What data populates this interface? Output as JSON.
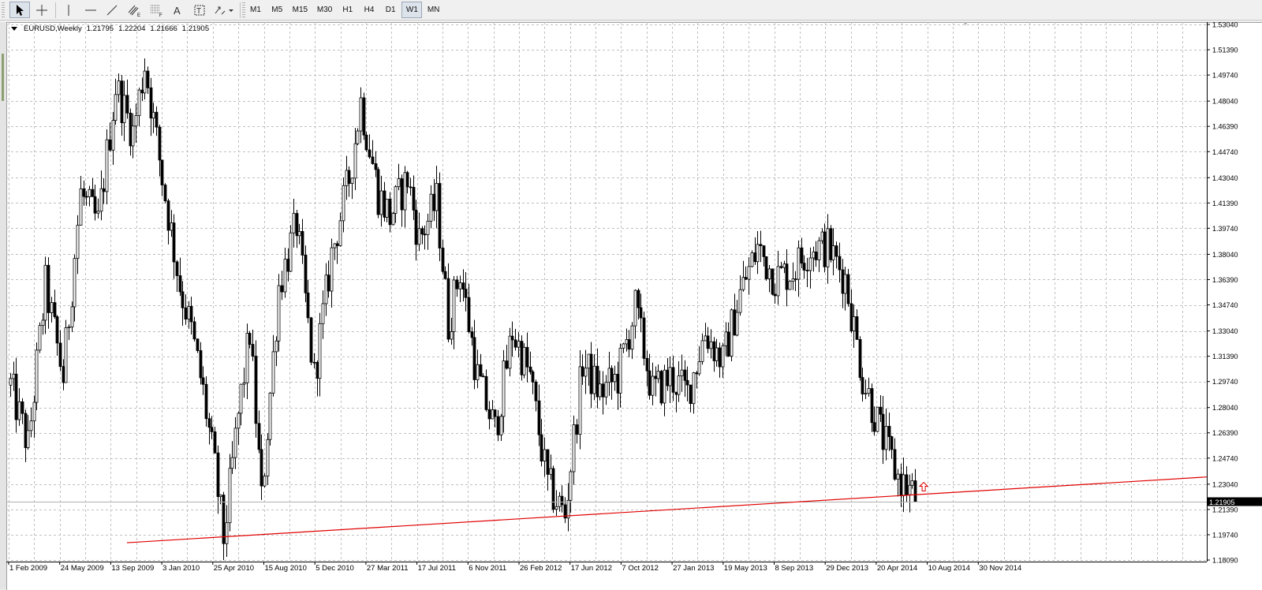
{
  "toolbar": {
    "tools": [
      "cursor-icon",
      "crosshair-icon",
      "vertical-line-icon",
      "horizontal-line-icon",
      "trendline-icon",
      "equidistant-channel-icon",
      "fibonacci-retracement-icon",
      "text-icon",
      "text-label-icon",
      "arrows-dropdown-icon"
    ],
    "timeframes": [
      "M1",
      "M5",
      "M15",
      "M30",
      "H1",
      "H4",
      "D1",
      "W1",
      "MN"
    ],
    "active_timeframe": "W1"
  },
  "chart": {
    "symbol": "EURUSD,Weekly",
    "open": "1.21795",
    "high": "1.22204",
    "low": "1.21666",
    "close": "1.21905",
    "current_price_label": "1.21905",
    "colors": {
      "trendline": "#e00000",
      "candle": "#000000",
      "grid": "#c0c0c0",
      "current_bg": "#000000",
      "arrow": "#e00000"
    }
  },
  "chart_data": {
    "type": "candlestick",
    "symbol": "EURUSD",
    "timeframe": "Weekly",
    "price_ticks": [
      "1.53040",
      "1.51390",
      "1.49740",
      "1.48040",
      "1.46390",
      "1.44740",
      "1.43040",
      "1.41390",
      "1.39740",
      "1.38040",
      "1.36390",
      "1.34740",
      "1.33040",
      "1.31390",
      "1.29740",
      "1.28040",
      "1.26390",
      "1.24740",
      "1.23040",
      "1.21390",
      "1.19740",
      "1.18090"
    ],
    "ylim": [
      1.1809,
      1.5304
    ],
    "date_labels": [
      "1 Feb 2009",
      "24 May 2009",
      "13 Sep 2009",
      "3 Jan 2010",
      "25 Apr 2010",
      "15 Aug 2010",
      "5 Dec 2010",
      "27 Mar 2011",
      "17 Jul 2011",
      "6 Nov 2011",
      "26 Feb 2012",
      "17 Jun 2012",
      "7 Oct 2012",
      "27 Jan 2013",
      "19 May 2013",
      "8 Sep 2013",
      "29 Dec 2013",
      "20 Apr 2014",
      "10 Aug 2014",
      "30 Nov 2014"
    ],
    "anchors": [
      [
        0,
        1.295
      ],
      [
        6,
        1.255
      ],
      [
        12,
        1.36
      ],
      [
        18,
        1.3
      ],
      [
        24,
        1.42
      ],
      [
        30,
        1.4
      ],
      [
        36,
        1.49
      ],
      [
        42,
        1.46
      ],
      [
        46,
        1.505
      ],
      [
        52,
        1.43
      ],
      [
        58,
        1.36
      ],
      [
        62,
        1.33
      ],
      [
        66,
        1.29
      ],
      [
        70,
        1.24
      ],
      [
        73,
        1.195
      ],
      [
        78,
        1.275
      ],
      [
        82,
        1.33
      ],
      [
        86,
        1.22
      ],
      [
        92,
        1.36
      ],
      [
        98,
        1.4
      ],
      [
        104,
        1.3
      ],
      [
        110,
        1.38
      ],
      [
        116,
        1.43
      ],
      [
        120,
        1.48
      ],
      [
        126,
        1.42
      ],
      [
        130,
        1.405
      ],
      [
        136,
        1.43
      ],
      [
        140,
        1.39
      ],
      [
        146,
        1.415
      ],
      [
        150,
        1.335
      ],
      [
        154,
        1.37
      ],
      [
        160,
        1.3
      ],
      [
        166,
        1.265
      ],
      [
        172,
        1.33
      ],
      [
        178,
        1.3
      ],
      [
        184,
        1.23
      ],
      [
        190,
        1.21
      ],
      [
        196,
        1.31
      ],
      [
        202,
        1.29
      ],
      [
        208,
        1.3
      ],
      [
        214,
        1.345
      ],
      [
        220,
        1.29
      ],
      [
        226,
        1.3
      ],
      [
        232,
        1.29
      ],
      [
        238,
        1.33
      ],
      [
        244,
        1.31
      ],
      [
        250,
        1.355
      ],
      [
        256,
        1.385
      ],
      [
        262,
        1.365
      ],
      [
        268,
        1.37
      ],
      [
        274,
        1.385
      ],
      [
        280,
        1.385
      ],
      [
        286,
        1.365
      ],
      [
        292,
        1.3
      ],
      [
        298,
        1.265
      ],
      [
        304,
        1.235
      ],
      [
        310,
        1.222
      ]
    ],
    "trendline": {
      "from": [
        40,
        1.1922
      ],
      "to": [
        331,
        1.2351
      ],
      "color": "#e00000"
    },
    "last_close": 1.21905
  }
}
